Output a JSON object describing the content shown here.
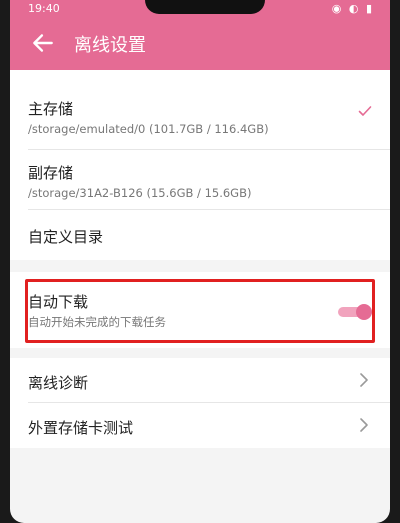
{
  "status_bar": {
    "time": "19:40",
    "system_icons": "◉ ◐ ▮"
  },
  "header": {
    "title": "离线设置",
    "back_icon": "arrow-left-icon"
  },
  "storage": {
    "primary": {
      "label": "主存储",
      "path": "/storage/emulated/0 (101.7GB / 116.4GB)",
      "selected": true
    },
    "secondary": {
      "label": "副存储",
      "path": "/storage/31A2-B126 (15.6GB / 15.6GB)",
      "selected": false
    },
    "custom": {
      "label": "自定义目录"
    }
  },
  "auto_download": {
    "label": "自动下载",
    "description": "自动开始未完成的下载任务",
    "enabled": true
  },
  "tools": {
    "diagnostics": {
      "label": "离线诊断"
    },
    "sd_card_test": {
      "label": "外置存储卡测试"
    }
  },
  "colors": {
    "accent": "#e56b94",
    "highlight_border": "#e12020"
  }
}
